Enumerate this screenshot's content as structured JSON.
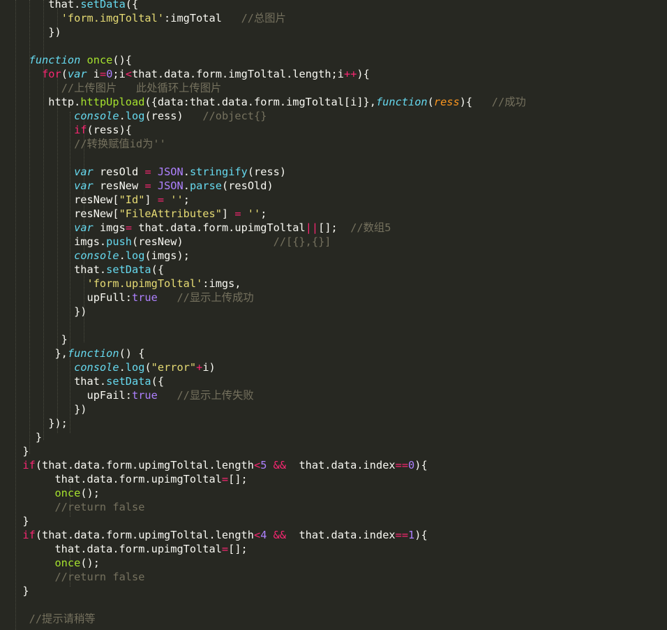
{
  "editor": {
    "language": "JavaScript",
    "theme_colors": {
      "background": "#272822",
      "plain": "#f8f8f2",
      "keyword": "#f92672",
      "storage": "#66d9ef",
      "entity": "#a6e22e",
      "string": "#e6db74",
      "number": "#ae81ff",
      "comment": "#75715e",
      "parameter": "#fd971f"
    },
    "lines": [
      [
        [
          "pl",
          "      that."
        ],
        [
          "sp",
          "setData"
        ],
        [
          "pl",
          "({"
        ]
      ],
      [
        [
          "pl",
          "        "
        ],
        [
          "s",
          "'form.imgToltal'"
        ],
        [
          "pl",
          ":imgTotal   "
        ],
        [
          "c",
          "//总图片"
        ]
      ],
      [
        [
          "pl",
          "      })"
        ]
      ],
      [
        [
          "pl",
          ""
        ]
      ],
      [
        [
          "pl",
          "   "
        ],
        [
          "st",
          "function"
        ],
        [
          "pl",
          " "
        ],
        [
          "en",
          "once"
        ],
        [
          "pl",
          "(){"
        ]
      ],
      [
        [
          "pl",
          "     "
        ],
        [
          "kw",
          "for"
        ],
        [
          "pl",
          "("
        ],
        [
          "st",
          "var"
        ],
        [
          "pl",
          " i"
        ],
        [
          "kw",
          "="
        ],
        [
          "n",
          "0"
        ],
        [
          "pl",
          ";i"
        ],
        [
          "kw",
          "<"
        ],
        [
          "pl",
          "that.data.form.imgToltal.length;i"
        ],
        [
          "kw",
          "++"
        ],
        [
          "pl",
          "){"
        ]
      ],
      [
        [
          "pl",
          "        "
        ],
        [
          "c",
          "//上传图片   此处循环上传图片"
        ]
      ],
      [
        [
          "pl",
          "      http."
        ],
        [
          "en",
          "httpUpload"
        ],
        [
          "pl",
          "({data:that.data.form.imgToltal[i]},"
        ],
        [
          "st",
          "function"
        ],
        [
          "pl",
          "("
        ],
        [
          "pa",
          "ress"
        ],
        [
          "pl",
          "){   "
        ],
        [
          "c",
          "//成功"
        ]
      ],
      [
        [
          "pl",
          "          "
        ],
        [
          "st",
          "console"
        ],
        [
          "pl",
          "."
        ],
        [
          "fn",
          "log"
        ],
        [
          "pl",
          "(ress)   "
        ],
        [
          "c",
          "//object{}"
        ]
      ],
      [
        [
          "pl",
          "          "
        ],
        [
          "kw",
          "if"
        ],
        [
          "pl",
          "(ress){"
        ]
      ],
      [
        [
          "pl",
          "          "
        ],
        [
          "c",
          "//转换赋值id为''"
        ]
      ],
      [
        [
          "pl",
          ""
        ]
      ],
      [
        [
          "pl",
          "          "
        ],
        [
          "st",
          "var"
        ],
        [
          "pl",
          " resOld "
        ],
        [
          "kw",
          "="
        ],
        [
          "pl",
          " "
        ],
        [
          "b",
          "JSON"
        ],
        [
          "pl",
          "."
        ],
        [
          "fn",
          "stringify"
        ],
        [
          "pl",
          "(ress)"
        ]
      ],
      [
        [
          "pl",
          "          "
        ],
        [
          "st",
          "var"
        ],
        [
          "pl",
          " resNew "
        ],
        [
          "kw",
          "="
        ],
        [
          "pl",
          " "
        ],
        [
          "b",
          "JSON"
        ],
        [
          "pl",
          "."
        ],
        [
          "fn",
          "parse"
        ],
        [
          "pl",
          "(resOld)"
        ]
      ],
      [
        [
          "pl",
          "          resNew["
        ],
        [
          "s",
          "\"Id\""
        ],
        [
          "pl",
          "] "
        ],
        [
          "kw",
          "="
        ],
        [
          "pl",
          " "
        ],
        [
          "s",
          "''"
        ],
        [
          "pl",
          ";"
        ]
      ],
      [
        [
          "pl",
          "          resNew["
        ],
        [
          "s",
          "\"FileAttributes\""
        ],
        [
          "pl",
          "] "
        ],
        [
          "kw",
          "="
        ],
        [
          "pl",
          " "
        ],
        [
          "s",
          "''"
        ],
        [
          "pl",
          ";"
        ]
      ],
      [
        [
          "pl",
          "          "
        ],
        [
          "st",
          "var"
        ],
        [
          "pl",
          " imgs"
        ],
        [
          "kw",
          "="
        ],
        [
          "pl",
          " that.data.form.upimgToltal"
        ],
        [
          "kw",
          "||"
        ],
        [
          "pl",
          "[];  "
        ],
        [
          "c",
          "//数组5"
        ]
      ],
      [
        [
          "pl",
          "          imgs."
        ],
        [
          "sp",
          "push"
        ],
        [
          "pl",
          "(resNew)              "
        ],
        [
          "c",
          "//[{},{}]"
        ]
      ],
      [
        [
          "pl",
          "          "
        ],
        [
          "st",
          "console"
        ],
        [
          "pl",
          "."
        ],
        [
          "fn",
          "log"
        ],
        [
          "pl",
          "(imgs);"
        ]
      ],
      [
        [
          "pl",
          "          that."
        ],
        [
          "sp",
          "setData"
        ],
        [
          "pl",
          "({"
        ]
      ],
      [
        [
          "pl",
          "            "
        ],
        [
          "s",
          "'form.upimgToltal'"
        ],
        [
          "pl",
          ":imgs,"
        ]
      ],
      [
        [
          "pl",
          "            upFull:"
        ],
        [
          "b",
          "true"
        ],
        [
          "pl",
          "   "
        ],
        [
          "c",
          "//显示上传成功"
        ]
      ],
      [
        [
          "pl",
          "          })"
        ]
      ],
      [
        [
          "pl",
          ""
        ]
      ],
      [
        [
          "pl",
          "        }"
        ]
      ],
      [
        [
          "pl",
          "       },"
        ],
        [
          "st",
          "function"
        ],
        [
          "pl",
          "() {"
        ]
      ],
      [
        [
          "pl",
          "          "
        ],
        [
          "st",
          "console"
        ],
        [
          "pl",
          "."
        ],
        [
          "fn",
          "log"
        ],
        [
          "pl",
          "("
        ],
        [
          "s",
          "\"error\""
        ],
        [
          "kw",
          "+"
        ],
        [
          "pl",
          "i)"
        ]
      ],
      [
        [
          "pl",
          "          that."
        ],
        [
          "sp",
          "setData"
        ],
        [
          "pl",
          "({"
        ]
      ],
      [
        [
          "pl",
          "            upFail:"
        ],
        [
          "b",
          "true"
        ],
        [
          "pl",
          "   "
        ],
        [
          "c",
          "//显示上传失败"
        ]
      ],
      [
        [
          "pl",
          "          })"
        ]
      ],
      [
        [
          "pl",
          "      });"
        ]
      ],
      [
        [
          "pl",
          "    }"
        ]
      ],
      [
        [
          "pl",
          "  }"
        ]
      ],
      [
        [
          "pl",
          "  "
        ],
        [
          "kw",
          "if"
        ],
        [
          "pl",
          "(that.data.form.upimgToltal.length"
        ],
        [
          "kw",
          "<"
        ],
        [
          "n",
          "5"
        ],
        [
          "pl",
          " "
        ],
        [
          "kw",
          "&&"
        ],
        [
          "pl",
          "  that.data.index"
        ],
        [
          "kw",
          "=="
        ],
        [
          "n",
          "0"
        ],
        [
          "pl",
          "){"
        ]
      ],
      [
        [
          "pl",
          "       that.data.form.upimgToltal"
        ],
        [
          "kw",
          "="
        ],
        [
          "pl",
          "[];"
        ]
      ],
      [
        [
          "pl",
          "       "
        ],
        [
          "en",
          "once"
        ],
        [
          "pl",
          "();"
        ]
      ],
      [
        [
          "pl",
          "       "
        ],
        [
          "c",
          "//return false"
        ]
      ],
      [
        [
          "pl",
          "  }"
        ]
      ],
      [
        [
          "pl",
          "  "
        ],
        [
          "kw",
          "if"
        ],
        [
          "pl",
          "(that.data.form.upimgToltal.length"
        ],
        [
          "kw",
          "<"
        ],
        [
          "n",
          "4"
        ],
        [
          "pl",
          " "
        ],
        [
          "kw",
          "&&"
        ],
        [
          "pl",
          "  that.data.index"
        ],
        [
          "kw",
          "=="
        ],
        [
          "n",
          "1"
        ],
        [
          "pl",
          "){"
        ]
      ],
      [
        [
          "pl",
          "       that.data.form.upimgToltal"
        ],
        [
          "kw",
          "="
        ],
        [
          "pl",
          "[];"
        ]
      ],
      [
        [
          "pl",
          "       "
        ],
        [
          "en",
          "once"
        ],
        [
          "pl",
          "();"
        ]
      ],
      [
        [
          "pl",
          "       "
        ],
        [
          "c",
          "//return false"
        ]
      ],
      [
        [
          "pl",
          "  }"
        ]
      ],
      [
        [
          "pl",
          ""
        ]
      ],
      [
        [
          "pl",
          "   "
        ],
        [
          "c",
          "//提示请稍等"
        ]
      ],
      [
        [
          "pl",
          "   "
        ]
      ]
    ]
  }
}
